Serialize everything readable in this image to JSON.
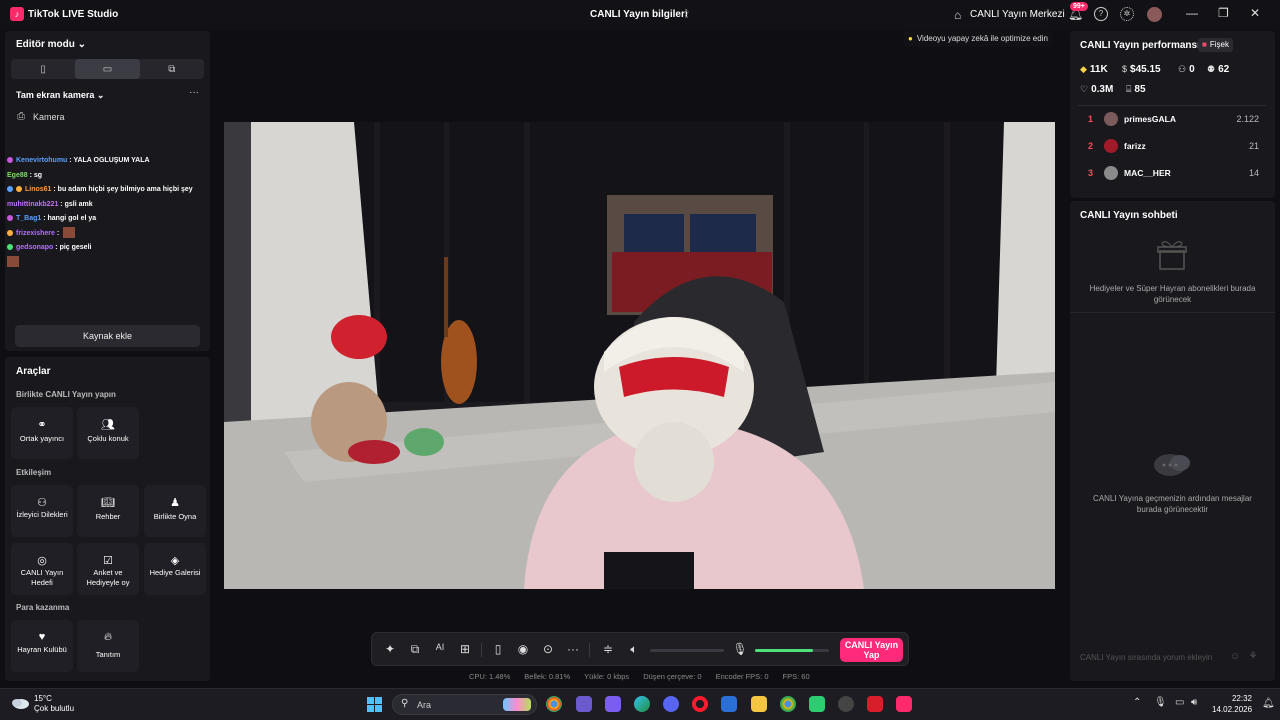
{
  "titlebar": {
    "app_name": "TikTok LIVE Studio",
    "center_title": "CANLI Yayın bilgileri",
    "live_center": "CANLI Yayın Merkezi",
    "notification_count": "99+"
  },
  "left_panel": {
    "editor_mode": "Editör modu",
    "scene_name": "Tam ekran kamera",
    "camera_label": "Kamera",
    "chat": [
      {
        "user": "Kenevirtohumu",
        "text": " : YALA OGLUŞUM YALA"
      },
      {
        "user": "Ege88",
        "text": " : sg"
      },
      {
        "user": "Linos61",
        "text": " : bu adam hiçbi şey bilmiyo ama hiçbi şey"
      },
      {
        "user": "muhittinakb221",
        "text": " : gsli amk"
      },
      {
        "user": "T_Bag1",
        "text": " : hangi gol el ya"
      },
      {
        "user": "frizexishere",
        "text": " : "
      },
      {
        "user": "gedsonapo",
        "text": " : piç geseli"
      }
    ],
    "add_source": "Kaynak ekle"
  },
  "tools": {
    "title": "Araçlar",
    "section_cohost": "Birlikte CANLI Yayın yapın",
    "cohost_items": [
      "Ortak yayıncı",
      "Çoklu konuk"
    ],
    "section_interaction": "Etkileşim",
    "interaction_items": [
      "İzleyici Dilekleri",
      "Rehber",
      "Birlikte Oyna",
      "CANLI Yayın Hedefi",
      "Anket ve Hediyeyle oy",
      "Hediye Galerisi"
    ],
    "section_monetize": "Para kazanma",
    "monetize_items": [
      "Hayran Kulübü",
      "Tanıtım"
    ]
  },
  "video": {
    "optimize_hint": "Videoyu yapay zekâ ile optimize edin"
  },
  "controls": {
    "go_live": "CANLI Yayın Yap",
    "volume_level": 0,
    "mic_level": 0.78
  },
  "stats": {
    "cpu": "CPU:  1.48%",
    "memory": "Bellek:  0.81%",
    "upload": "Yükle:  0 kbps",
    "dropped": "Düşen çerçeve:  0",
    "encoder_fps": "Encoder FPS:  0",
    "fps": "FPS:  60"
  },
  "performance": {
    "title": "CANLI Yayın performansı",
    "fisek": "Fişek",
    "diamonds": "11K",
    "earnings": "$45.15",
    "new_followers": "0",
    "viewers": "62",
    "likes": "0.3M",
    "gifters": "85",
    "ranking": [
      {
        "rank": "1",
        "name": "primesGALA",
        "score": "2.122"
      },
      {
        "rank": "2",
        "name": "farizz",
        "score": "21"
      },
      {
        "rank": "3",
        "name": "MAC__HER",
        "score": "14"
      }
    ]
  },
  "live_chat": {
    "title": "CANLI Yayın sohbeti",
    "gifts_empty": "Hediyeler ve Süper Hayran abonelikleri burada görünecek",
    "messages_empty": "CANLI Yayına geçmenizin ardından mesajlar burada görünecektir",
    "input_placeholder": "CANLI Yayın sırasında yorum ekleyin"
  },
  "taskbar": {
    "temperature": "15°C",
    "weather": "Çok bulutlu",
    "search_placeholder": "Ara",
    "time": "22:32",
    "date": "14.02.2026"
  },
  "colors": {
    "accent": "#ff2a7a",
    "mic_meter": "#4ee07a",
    "rank": "#ff4a5a"
  }
}
